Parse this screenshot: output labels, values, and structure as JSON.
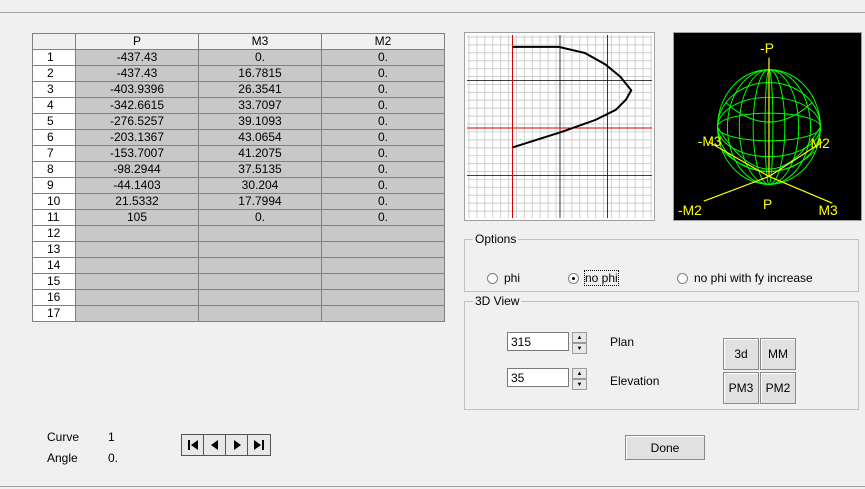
{
  "table": {
    "headers": [
      "",
      "P",
      "M3",
      "M2"
    ],
    "rows": [
      [
        "1",
        "-437.43",
        "0.",
        "0."
      ],
      [
        "2",
        "-437.43",
        "16.7815",
        "0."
      ],
      [
        "3",
        "-403.9396",
        "26.3541",
        "0."
      ],
      [
        "4",
        "-342.6615",
        "33.7097",
        "0."
      ],
      [
        "5",
        "-276.5257",
        "39.1093",
        "0."
      ],
      [
        "6",
        "-203.1367",
        "43.0654",
        "0."
      ],
      [
        "7",
        "-153.7007",
        "41.2075",
        "0."
      ],
      [
        "8",
        "-98.2944",
        "37.5135",
        "0."
      ],
      [
        "9",
        "-44.1403",
        "30.204",
        "0."
      ],
      [
        "10",
        "21.5332",
        "17.7994",
        "0."
      ],
      [
        "11",
        "105",
        "0.",
        "0."
      ],
      [
        "12",
        "",
        "",
        ""
      ],
      [
        "13",
        "",
        "",
        ""
      ],
      [
        "14",
        "",
        "",
        ""
      ],
      [
        "15",
        "",
        "",
        ""
      ],
      [
        "16",
        "",
        "",
        ""
      ],
      [
        "17",
        "",
        "",
        ""
      ]
    ]
  },
  "view3d": {
    "labels": [
      "-P",
      "-M3",
      "M2",
      "-M2",
      "P",
      "M3"
    ],
    "mesh_color": "#00ff00",
    "axis_color": "#ffff00"
  },
  "options": {
    "legend": "Options",
    "choices": [
      "phi",
      "no phi",
      "no phi with fy increase"
    ],
    "selected": "no phi"
  },
  "view3d_box": {
    "legend": "3D View",
    "plan_value": "315",
    "plan_label": "Plan",
    "elevation_value": "35",
    "elevation_label": "Elevation",
    "buttons": [
      "3d",
      "MM",
      "PM3",
      "PM2"
    ]
  },
  "footer": {
    "curve_label": "Curve",
    "curve_value": "1",
    "angle_label": "Angle",
    "angle_value": "0.",
    "done_label": "Done"
  },
  "icons": [
    "first-icon",
    "prev-icon",
    "next-icon",
    "last-icon"
  ]
}
